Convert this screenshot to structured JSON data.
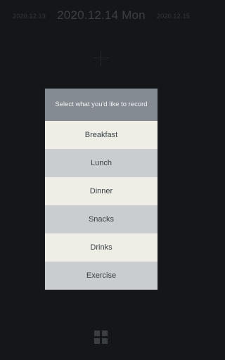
{
  "date_nav": {
    "prev_date": "2020.12.13",
    "current_date": "2020.12.14 Mon",
    "next_date": "2020.12.15"
  },
  "add_icon": "plus-icon",
  "dialog": {
    "title": "Select what you'd like to record",
    "options": [
      {
        "label": "Breakfast"
      },
      {
        "label": "Lunch"
      },
      {
        "label": "Dinner"
      },
      {
        "label": "Snacks"
      },
      {
        "label": "Drinks"
      },
      {
        "label": "Exercise"
      }
    ]
  },
  "bottom_icon": "grid-icon",
  "colors": {
    "background": "#141619",
    "dialog_header": "#848b92",
    "option_light": "#eeede6",
    "option_dark": "#c9cdd0"
  }
}
